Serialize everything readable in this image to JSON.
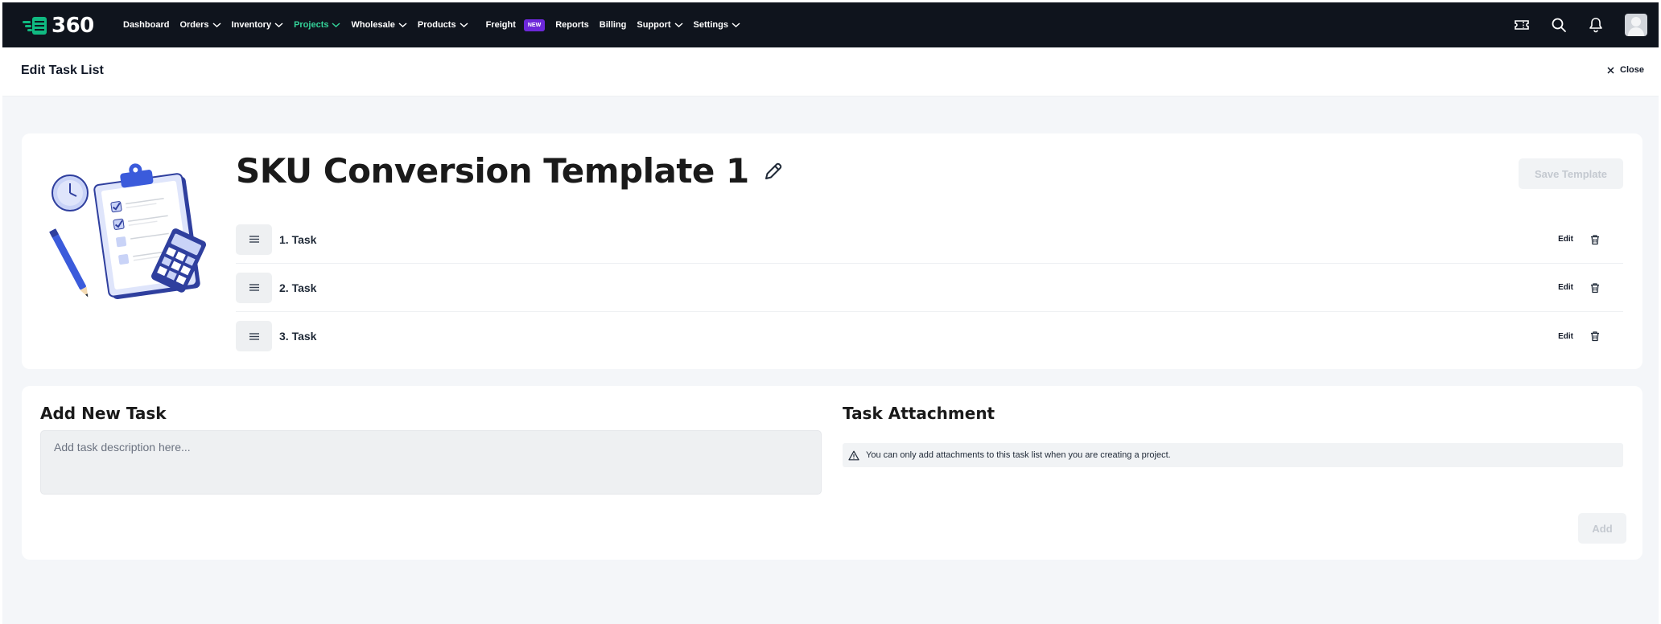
{
  "app": {
    "logo_text": "360",
    "brand_color": "#10b981",
    "nav_bg": "#0f141d"
  },
  "nav": {
    "items": [
      {
        "label": "Dashboard",
        "has_dropdown": false
      },
      {
        "label": "Orders",
        "has_dropdown": true
      },
      {
        "label": "Inventory",
        "has_dropdown": true
      },
      {
        "label": "Projects",
        "has_dropdown": true,
        "active": true
      },
      {
        "label": "Wholesale",
        "has_dropdown": true
      },
      {
        "label": "Products",
        "has_dropdown": true
      },
      {
        "label": "Freight",
        "has_dropdown": false,
        "badge": "NEW"
      },
      {
        "label": "Reports",
        "has_dropdown": false
      },
      {
        "label": "Billing",
        "has_dropdown": false
      },
      {
        "label": "Support",
        "has_dropdown": true
      },
      {
        "label": "Settings",
        "has_dropdown": true
      }
    ],
    "right_icons": [
      "ticket-icon",
      "search-icon",
      "bell-icon",
      "avatar"
    ]
  },
  "header": {
    "title": "Edit Task List",
    "close_label": "Close"
  },
  "template": {
    "name": "SKU Conversion Template 1",
    "save_label": "Save Template",
    "tasks": [
      {
        "label": "1. Task",
        "edit_label": "Edit"
      },
      {
        "label": "2. Task",
        "edit_label": "Edit"
      },
      {
        "label": "3. Task",
        "edit_label": "Edit"
      }
    ]
  },
  "add_task": {
    "title": "Add New Task",
    "placeholder": "Add task description here...",
    "add_label": "Add"
  },
  "attachment": {
    "title": "Task Attachment",
    "info_text": "You can only add attachments to this task list when you are creating a project."
  }
}
